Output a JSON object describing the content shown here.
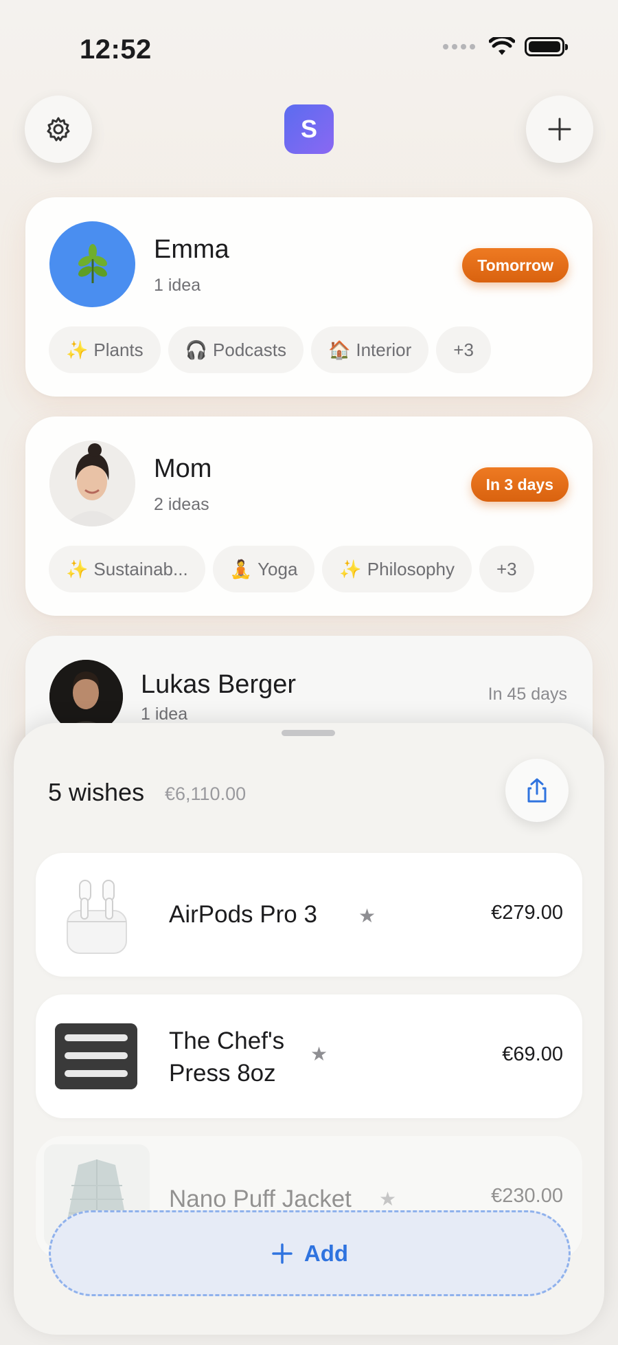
{
  "status": {
    "time": "12:52"
  },
  "header": {
    "profile_initial": "S"
  },
  "people": [
    {
      "name": "Emma",
      "ideas": "1 idea",
      "date": "Tomorrow",
      "tags": [
        {
          "emoji": "✨",
          "label": "Plants"
        },
        {
          "emoji": "🎧",
          "label": "Podcasts"
        },
        {
          "emoji": "🏠",
          "label": "Interior"
        },
        {
          "emoji": "",
          "label": "+3"
        }
      ]
    },
    {
      "name": "Mom",
      "ideas": "2 ideas",
      "date": "In 3 days",
      "tags": [
        {
          "emoji": "✨",
          "label": "Sustainab..."
        },
        {
          "emoji": "🧘",
          "label": "Yoga"
        },
        {
          "emoji": "✨",
          "label": "Philosophy"
        },
        {
          "emoji": "",
          "label": "+3"
        }
      ]
    },
    {
      "name": "Lukas Berger",
      "ideas": "1 idea",
      "date": "In 45 days"
    }
  ],
  "sheet": {
    "title": "5 wishes",
    "total": "€6,110.00",
    "add_label": "Add",
    "items": [
      {
        "name": "AirPods Pro 3",
        "price": "€279.00",
        "star": "★"
      },
      {
        "name": "The Chef's Press 8oz",
        "price": "€69.00",
        "star": "★"
      },
      {
        "name": "Nano Puff Jacket",
        "price": "€230.00",
        "star": "★"
      }
    ]
  },
  "colors": {
    "accent": "#2f73df",
    "badge": "#e26c16",
    "profile": "#6b6af1"
  }
}
